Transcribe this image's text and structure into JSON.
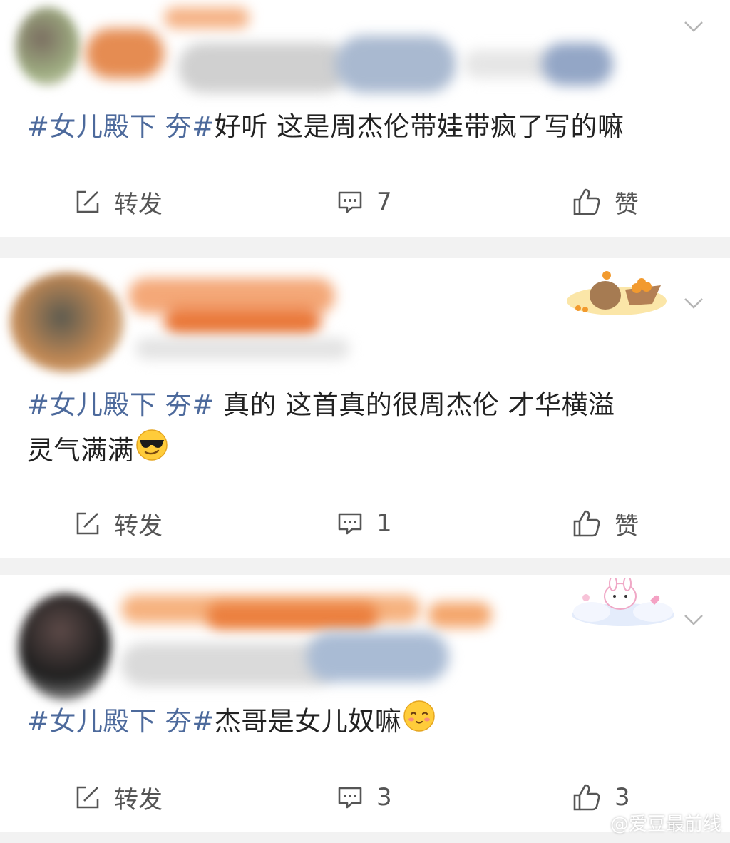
{
  "posts": [
    {
      "hashtag": "#女儿殿下 夯#",
      "body": "好听 这是周杰伦带娃带疯了写的嘛",
      "body_line2": "",
      "actions": {
        "repost": "转发",
        "comment": "7",
        "like": "赞"
      },
      "emoji": ""
    },
    {
      "hashtag": "#女儿殿下 夯#",
      "body": " 真的 这首真的很周杰伦 才华横溢",
      "body_line2": "灵气满满",
      "actions": {
        "repost": "转发",
        "comment": "1",
        "like": "赞"
      },
      "emoji": "sunglasses-emoji"
    },
    {
      "hashtag": "#女儿殿下 夯#",
      "body": "杰哥是女儿奴嘛",
      "body_line2": "",
      "actions": {
        "repost": "转发",
        "comment": "3",
        "like": "3"
      },
      "emoji": "blush-emoji"
    }
  ],
  "watermark": {
    "text": "@爱豆最前线",
    "icon": "weibo-logo-icon"
  },
  "colors": {
    "hashtag": "#4d6a9c",
    "text": "#222222",
    "action": "#555555",
    "background": "#f2f2f2"
  }
}
